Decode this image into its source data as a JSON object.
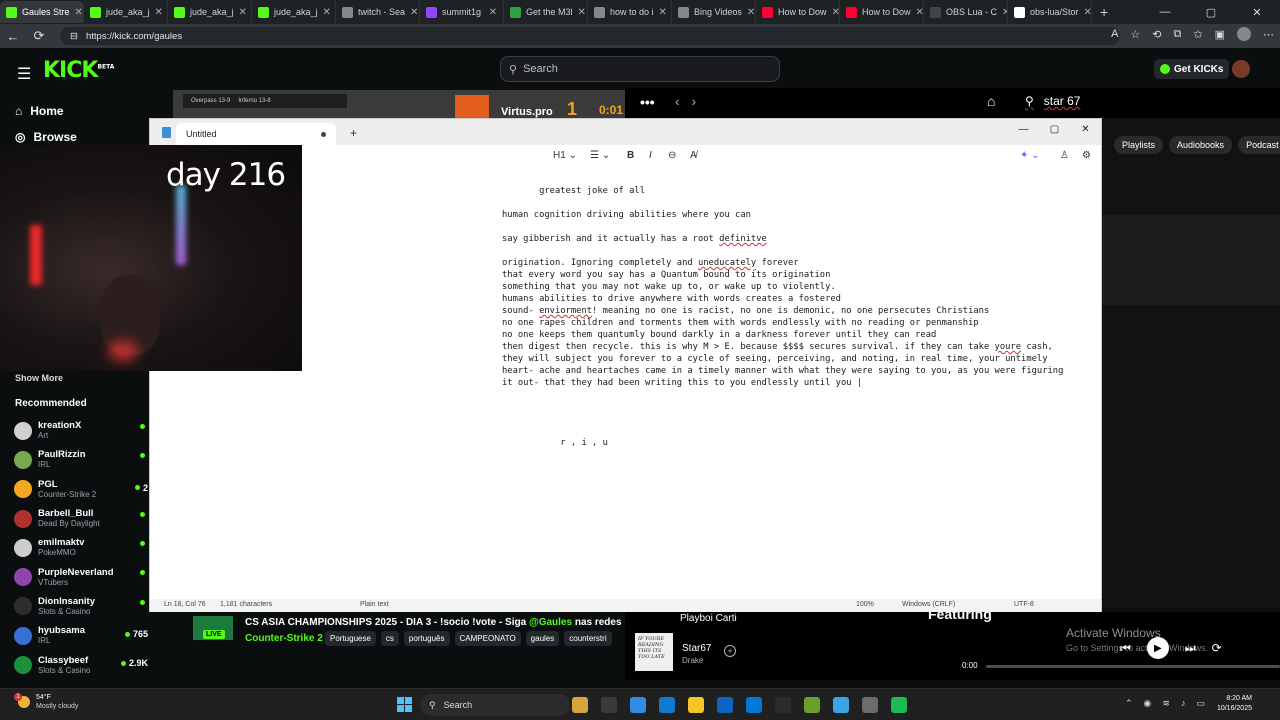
{
  "browser": {
    "tabs": [
      {
        "title": "Gaules Stre",
        "color": "#53fc18",
        "active": true
      },
      {
        "title": "jude_aka_j",
        "color": "#53fc18"
      },
      {
        "title": "jude_aka_j",
        "color": "#53fc18"
      },
      {
        "title": "jude_aka_j",
        "color": "#53fc18"
      },
      {
        "title": "twitch - Sea",
        "color": "#888888"
      },
      {
        "title": "summit1g",
        "color": "#9146ff"
      },
      {
        "title": "Get the M3l",
        "color": "#2ea043"
      },
      {
        "title": "how to do i",
        "color": "#888888"
      },
      {
        "title": "Bing Videos",
        "color": "#888888"
      },
      {
        "title": "How to Dow",
        "color": "#ff0033"
      },
      {
        "title": "How to Dow",
        "color": "#ff0033"
      },
      {
        "title": "OBS Lua - C",
        "color": "#444444"
      },
      {
        "title": "obs-lua/Stor",
        "color": "#ffffff"
      }
    ],
    "url": "https://kick.com/gaules"
  },
  "kick": {
    "search_placeholder": "Search",
    "get_kicks": "Get KICKs",
    "logo_badge": "BETA",
    "nav": [
      {
        "label": "Home",
        "icon": "home-icon"
      },
      {
        "label": "Browse",
        "icon": "compass-icon"
      }
    ],
    "show_more": "Show More",
    "recommended_title": "Recommended",
    "recommended": [
      {
        "name": "kreationX",
        "category": "Art",
        "viewers": "",
        "color": "#d0d0d0"
      },
      {
        "name": "PaulRizzin",
        "category": "IRL",
        "viewers": "",
        "color": "#7aa850"
      },
      {
        "name": "PGL",
        "category": "Counter-Strike 2",
        "viewers": "2",
        "color": "#f5a623"
      },
      {
        "name": "Barbell_Bull",
        "category": "Dead By Daylight",
        "viewers": "",
        "color": "#b03030"
      },
      {
        "name": "emilmaktv",
        "category": "PokeMMO",
        "viewers": "",
        "color": "#cccccc"
      },
      {
        "name": "PurpleNeverland",
        "category": "VTubers",
        "viewers": "",
        "color": "#8e44ad"
      },
      {
        "name": "DionInsanity",
        "category": "Slots & Casino",
        "viewers": "",
        "color": "#2d2d2d"
      },
      {
        "name": "hyubsama",
        "category": "IRL",
        "viewers": "765",
        "color": "#3a6fd8"
      },
      {
        "name": "Classybeef",
        "category": "Slots & Casino",
        "viewers": "2.9K",
        "color": "#1b8f3c"
      }
    ],
    "stream_title_pre": "CS ASIA CHAMPIONSHIPS 2025 - DIA 3 - !socio !vote - Siga ",
    "stream_title_mention": "@Gaules",
    "stream_title_post": " nas redes soci",
    "live_label": "LIVE",
    "stream_category": "Counter-Strike 2",
    "tags": [
      "Portuguese",
      "cs",
      "português",
      "CAMPEONATO",
      "gaules",
      "counterstri"
    ],
    "scoreboard": {
      "map1": "Overpass 13-9",
      "map2": "Inferno 13-8",
      "team": "Virtus.pro",
      "score": "1",
      "time": "0:01"
    }
  },
  "webcam": {
    "overlay_text": "day 216"
  },
  "spotify": {
    "search_text": "star 67",
    "chips": [
      "Playlists",
      "Audiobooks",
      "Podcast"
    ],
    "now_playing_artist_header": "Playboi Carti",
    "featuring_label": "Featuring",
    "track": "Star67",
    "artist": "Drake",
    "album_text": "IF YOURE READING THIS ITS TOO LATE",
    "current_time": "0:00",
    "progress": 0.0,
    "activate_title": "Activate Windows",
    "activate_sub": "Go to Settings to activate Windows."
  },
  "notepad": {
    "tab_title": "Untitled",
    "heading_label": "H1",
    "lines": [
      {
        "text": "       greatest joke of all"
      },
      {
        "text": ""
      },
      {
        "text": "human cognition driving abilities where you can"
      },
      {
        "text": ""
      },
      {
        "pre": "say gibberish and it actually has a root ",
        "sq": "definitve",
        "post": ""
      },
      {
        "text": ""
      },
      {
        "pre": "origination. Ignoring completely and ",
        "sq": "uneducately",
        "post": " forever"
      },
      {
        "text": "that every word you say has a Quantum bound to its origination"
      },
      {
        "text": "something that you may not wake up to, or wake up to violently."
      },
      {
        "text": "humans abilities to drive anywhere with words creates a fostered"
      },
      {
        "pre": "sound- ",
        "sq": "enviorment",
        "post": "! meaning no one is racist, no one is demonic, no one persecutes Christians"
      },
      {
        "text": "no one rapes children and torments them with words endlessly with no reading or penmanship"
      },
      {
        "text": "no one keeps them quantumly bound darkly in a darkness forever until they can read"
      },
      {
        "pre": "then digest then recycle. this is why M > E. because $$$$ secures survival. if they can take ",
        "sq": "youre",
        "post": " cash,"
      },
      {
        "text": "they will subject you forever to a cycle of seeing, perceiving, and noting, in real time, your untimely"
      },
      {
        "text": "heart- ache and heartaches came in a timely manner with what they were saying to you, as you were figuring"
      },
      {
        "text": "it out- that they had been writing this to you endlessly until you |"
      },
      {
        "text": ""
      },
      {
        "text": ""
      },
      {
        "text": ""
      },
      {
        "text": ""
      },
      {
        "text": "           r , i , u"
      }
    ],
    "status": {
      "position": "Ln 18, Col 76",
      "characters": "1,181 characters",
      "format": "Plain text",
      "zoom": "100%",
      "line_ending": "Windows (CRLF)",
      "encoding": "UTF-8"
    }
  },
  "taskbar": {
    "temp": "54°F",
    "weather": "Mostly cloudy",
    "weather_badge": "1",
    "search": "Search",
    "time": "8:20 AM",
    "date": "10/16/2025",
    "app_colors": [
      "#d9a53b",
      "#3a3a3a",
      "#2f8de4",
      "#0f7ad1",
      "#f3c623",
      "#0a66c2",
      "#0078d4",
      "#2b2b2b",
      "#6f9d2b",
      "#3ba4e8",
      "#6c6c6c",
      "#1db954"
    ]
  }
}
